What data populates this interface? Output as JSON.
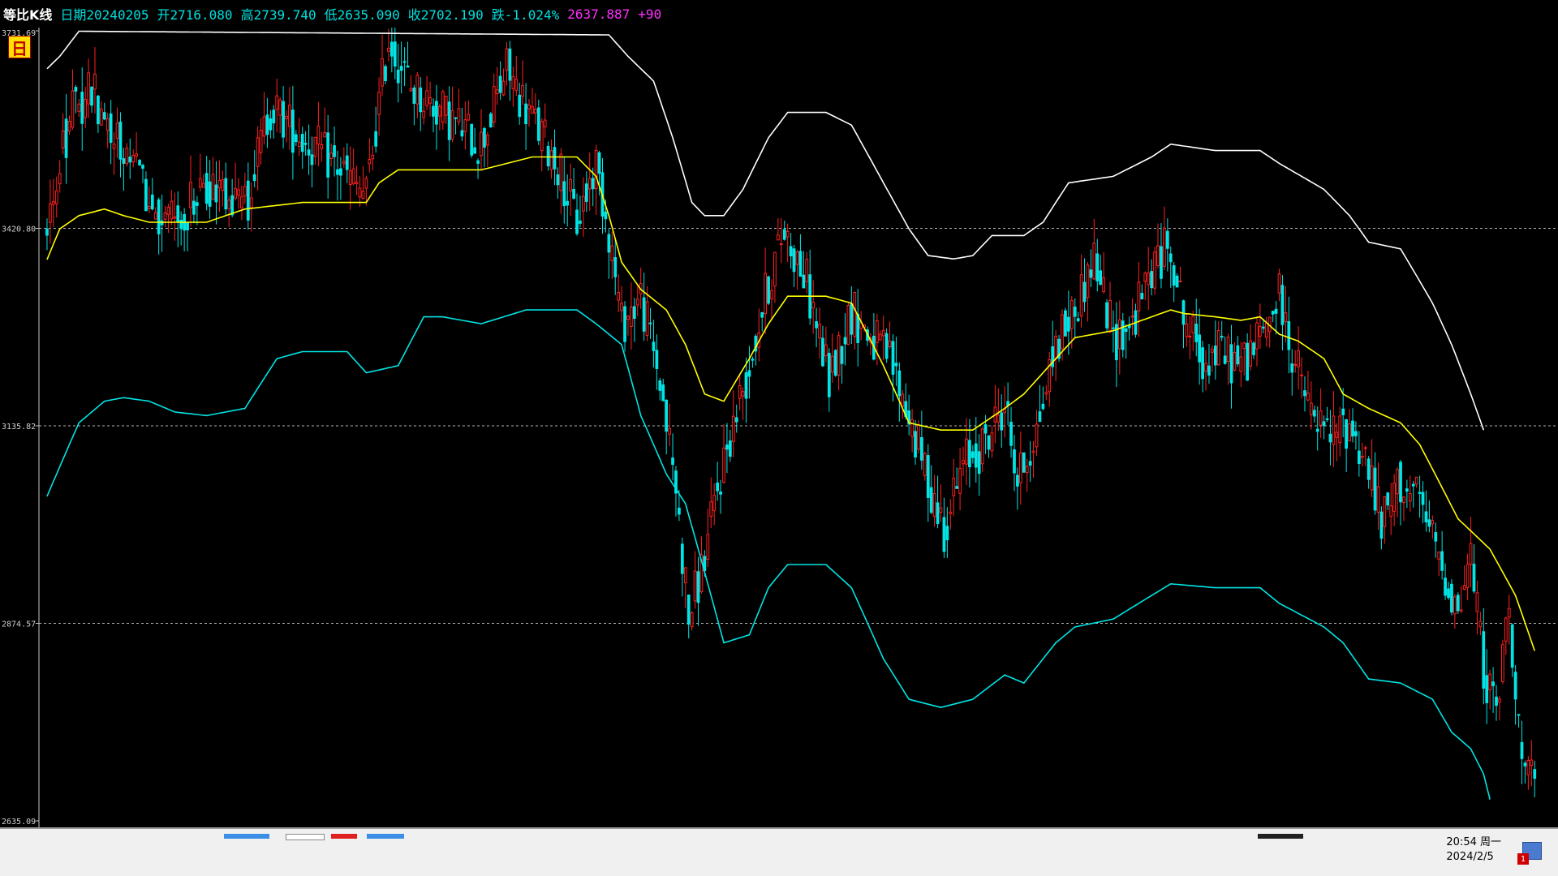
{
  "header": {
    "title": "等比K线",
    "date": "日期20240205",
    "open": "开2716.080",
    "high": "高2739.740",
    "low": "低2635.090",
    "close": "收2702.190",
    "change": "跌-1.024%",
    "cursor_value": "2637.887",
    "offset": "+90"
  },
  "period_badge": "日",
  "taskbar": {
    "time": "20:54 周一",
    "date": "2024/2/5",
    "badge": "1"
  },
  "colors": {
    "background": "#000000",
    "up": "#ff2020",
    "down": "#00e5e5",
    "ma": "#ffff00",
    "upper_band": "#ffffff",
    "lower_band": "#00e5e5",
    "axis_text": "#d0d0d0"
  },
  "chart_data": {
    "type": "candlestick",
    "log_scale": true,
    "ylim": [
      2635.09,
      3731.69
    ],
    "y_ticks": [
      {
        "value": 3731.69,
        "label": "3731.69",
        "gridline": false
      },
      {
        "value": 3420.8,
        "label": "3420.80",
        "gridline": true
      },
      {
        "value": 3135.82,
        "label": "3135.82",
        "gridline": true
      },
      {
        "value": 2874.57,
        "label": "2874.57",
        "gridline": true
      },
      {
        "value": 2635.09,
        "label": "2635.09",
        "gridline": false
      }
    ],
    "total_slots": 470,
    "anchors": [
      [
        0,
        3420
      ],
      [
        7,
        3590
      ],
      [
        14,
        3640
      ],
      [
        22,
        3560
      ],
      [
        30,
        3480
      ],
      [
        38,
        3420
      ],
      [
        46,
        3460
      ],
      [
        54,
        3500
      ],
      [
        62,
        3450
      ],
      [
        70,
        3610
      ],
      [
        80,
        3560
      ],
      [
        90,
        3520
      ],
      [
        100,
        3470
      ],
      [
        107,
        3720
      ],
      [
        114,
        3640
      ],
      [
        124,
        3600
      ],
      [
        136,
        3550
      ],
      [
        144,
        3670
      ],
      [
        152,
        3590
      ],
      [
        160,
        3520
      ],
      [
        166,
        3430
      ],
      [
        172,
        3520
      ],
      [
        176,
        3420
      ],
      [
        180,
        3280
      ],
      [
        186,
        3320
      ],
      [
        192,
        3200
      ],
      [
        197,
        3050
      ],
      [
        201,
        2880
      ],
      [
        206,
        2960
      ],
      [
        212,
        3090
      ],
      [
        220,
        3220
      ],
      [
        226,
        3340
      ],
      [
        231,
        3420
      ],
      [
        238,
        3340
      ],
      [
        245,
        3200
      ],
      [
        252,
        3300
      ],
      [
        258,
        3260
      ],
      [
        264,
        3230
      ],
      [
        270,
        3150
      ],
      [
        276,
        3060
      ],
      [
        281,
        3000
      ],
      [
        288,
        3090
      ],
      [
        294,
        3110
      ],
      [
        300,
        3170
      ],
      [
        304,
        3060
      ],
      [
        310,
        3130
      ],
      [
        316,
        3250
      ],
      [
        322,
        3300
      ],
      [
        328,
        3380
      ],
      [
        334,
        3260
      ],
      [
        340,
        3280
      ],
      [
        346,
        3360
      ],
      [
        352,
        3400
      ],
      [
        356,
        3290
      ],
      [
        362,
        3230
      ],
      [
        368,
        3240
      ],
      [
        374,
        3220
      ],
      [
        380,
        3260
      ],
      [
        386,
        3320
      ],
      [
        390,
        3240
      ],
      [
        396,
        3150
      ],
      [
        402,
        3120
      ],
      [
        408,
        3140
      ],
      [
        414,
        3080
      ],
      [
        418,
        3000
      ],
      [
        424,
        3060
      ],
      [
        430,
        3030
      ],
      [
        436,
        2960
      ],
      [
        442,
        2890
      ],
      [
        446,
        2960
      ],
      [
        450,
        2820
      ],
      [
        454,
        2760
      ],
      [
        458,
        2900
      ],
      [
        462,
        2700
      ],
      [
        466,
        2670
      ]
    ],
    "ma_anchors": [
      [
        0,
        3374
      ],
      [
        4,
        3420
      ],
      [
        10,
        3440
      ],
      [
        18,
        3450
      ],
      [
        24,
        3440
      ],
      [
        32,
        3430
      ],
      [
        40,
        3430
      ],
      [
        50,
        3430
      ],
      [
        62,
        3450
      ],
      [
        80,
        3460
      ],
      [
        100,
        3460
      ],
      [
        104,
        3490
      ],
      [
        110,
        3510
      ],
      [
        120,
        3510
      ],
      [
        136,
        3510
      ],
      [
        152,
        3530
      ],
      [
        166,
        3530
      ],
      [
        172,
        3500
      ],
      [
        176,
        3440
      ],
      [
        180,
        3370
      ],
      [
        186,
        3330
      ],
      [
        194,
        3300
      ],
      [
        200,
        3250
      ],
      [
        206,
        3180
      ],
      [
        212,
        3170
      ],
      [
        220,
        3230
      ],
      [
        226,
        3280
      ],
      [
        232,
        3320
      ],
      [
        244,
        3320
      ],
      [
        252,
        3310
      ],
      [
        262,
        3220
      ],
      [
        270,
        3140
      ],
      [
        280,
        3130
      ],
      [
        290,
        3130
      ],
      [
        300,
        3160
      ],
      [
        306,
        3180
      ],
      [
        316,
        3230
      ],
      [
        322,
        3260
      ],
      [
        334,
        3270
      ],
      [
        346,
        3290
      ],
      [
        352,
        3300
      ],
      [
        356,
        3295
      ],
      [
        366,
        3290
      ],
      [
        374,
        3285
      ],
      [
        380,
        3290
      ],
      [
        386,
        3265
      ],
      [
        392,
        3255
      ],
      [
        400,
        3230
      ],
      [
        406,
        3180
      ],
      [
        414,
        3160
      ],
      [
        424,
        3140
      ],
      [
        430,
        3110
      ],
      [
        436,
        3060
      ],
      [
        442,
        3010
      ],
      [
        452,
        2970
      ],
      [
        460,
        2910
      ],
      [
        466,
        2840
      ]
    ],
    "upper_anchors": [
      [
        0,
        3670
      ],
      [
        4,
        3690
      ],
      [
        10,
        3731
      ],
      [
        176,
        3725
      ],
      [
        182,
        3690
      ],
      [
        190,
        3650
      ],
      [
        196,
        3560
      ],
      [
        202,
        3460
      ],
      [
        206,
        3440
      ],
      [
        212,
        3440
      ],
      [
        218,
        3480
      ],
      [
        226,
        3560
      ],
      [
        232,
        3600
      ],
      [
        244,
        3600
      ],
      [
        252,
        3580
      ],
      [
        262,
        3490
      ],
      [
        270,
        3420
      ],
      [
        276,
        3380
      ],
      [
        284,
        3375
      ],
      [
        290,
        3380
      ],
      [
        296,
        3410
      ],
      [
        306,
        3410
      ],
      [
        312,
        3430
      ],
      [
        320,
        3490
      ],
      [
        334,
        3500
      ],
      [
        346,
        3530
      ],
      [
        352,
        3550
      ],
      [
        366,
        3540
      ],
      [
        380,
        3540
      ],
      [
        386,
        3520
      ],
      [
        400,
        3480
      ],
      [
        408,
        3440
      ],
      [
        414,
        3400
      ],
      [
        424,
        3390
      ],
      [
        434,
        3310
      ],
      [
        440,
        3250
      ],
      [
        446,
        3180
      ],
      [
        450,
        3130
      ]
    ],
    "lower_anchors": [
      [
        0,
        3040
      ],
      [
        4,
        3080
      ],
      [
        10,
        3140
      ],
      [
        18,
        3170
      ],
      [
        24,
        3175
      ],
      [
        32,
        3170
      ],
      [
        40,
        3155
      ],
      [
        50,
        3150
      ],
      [
        62,
        3160
      ],
      [
        72,
        3230
      ],
      [
        80,
        3240
      ],
      [
        94,
        3240
      ],
      [
        100,
        3210
      ],
      [
        110,
        3220
      ],
      [
        118,
        3290
      ],
      [
        124,
        3290
      ],
      [
        136,
        3280
      ],
      [
        150,
        3300
      ],
      [
        166,
        3300
      ],
      [
        172,
        3280
      ],
      [
        180,
        3250
      ],
      [
        186,
        3150
      ],
      [
        194,
        3070
      ],
      [
        200,
        3030
      ],
      [
        206,
        2940
      ],
      [
        212,
        2850
      ],
      [
        220,
        2860
      ],
      [
        226,
        2920
      ],
      [
        232,
        2950
      ],
      [
        244,
        2950
      ],
      [
        252,
        2920
      ],
      [
        262,
        2830
      ],
      [
        270,
        2780
      ],
      [
        280,
        2770
      ],
      [
        290,
        2780
      ],
      [
        300,
        2810
      ],
      [
        306,
        2800
      ],
      [
        316,
        2850
      ],
      [
        322,
        2870
      ],
      [
        334,
        2880
      ],
      [
        346,
        2910
      ],
      [
        352,
        2925
      ],
      [
        366,
        2920
      ],
      [
        380,
        2920
      ],
      [
        386,
        2900
      ],
      [
        400,
        2870
      ],
      [
        406,
        2850
      ],
      [
        414,
        2805
      ],
      [
        424,
        2800
      ],
      [
        434,
        2780
      ],
      [
        440,
        2740
      ],
      [
        446,
        2720
      ],
      [
        450,
        2690
      ],
      [
        452,
        2660
      ]
    ]
  }
}
